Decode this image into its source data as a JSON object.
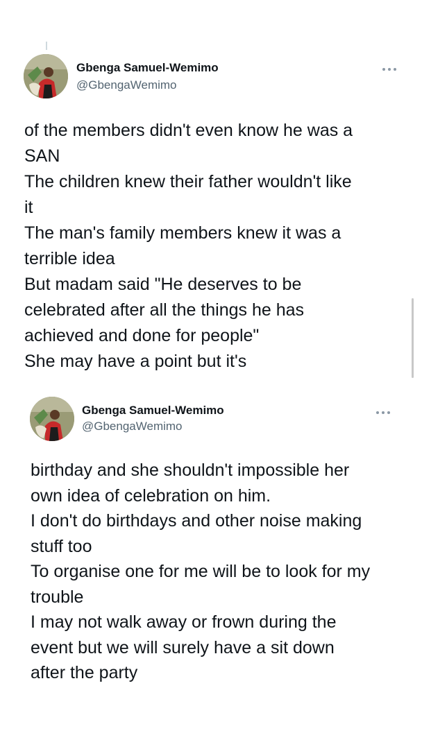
{
  "tweets": [
    {
      "author_name": "Gbenga Samuel-Wemimo",
      "handle": "@GbengaWemimo",
      "more_icon": "more-horizontal-icon",
      "body": "of the members didn't even know he was a\nSAN\nThe children knew their father wouldn't like\nit\nThe man's family members knew it was a\nterrible idea\nBut madam said \"He deserves to be\ncelebrated after all the things he has\nachieved and done for people\"\nShe may have a point but it's"
    },
    {
      "author_name": "Gbenga Samuel-Wemimo",
      "handle": "@GbengaWemimo",
      "more_icon": "more-horizontal-icon",
      "body": "birthday and she shouldn't impossible her\nown idea of celebration on him.\nI don't do birthdays and other noise making\nstuff too\nTo organise one for me will be to look for my\ntrouble\nI may not walk away or frown during the\nevent but we will surely have a sit down\nafter the party"
    }
  ],
  "colors": {
    "text": "#0f1419",
    "secondary": "#536471",
    "thread_line": "#cfd9de"
  }
}
